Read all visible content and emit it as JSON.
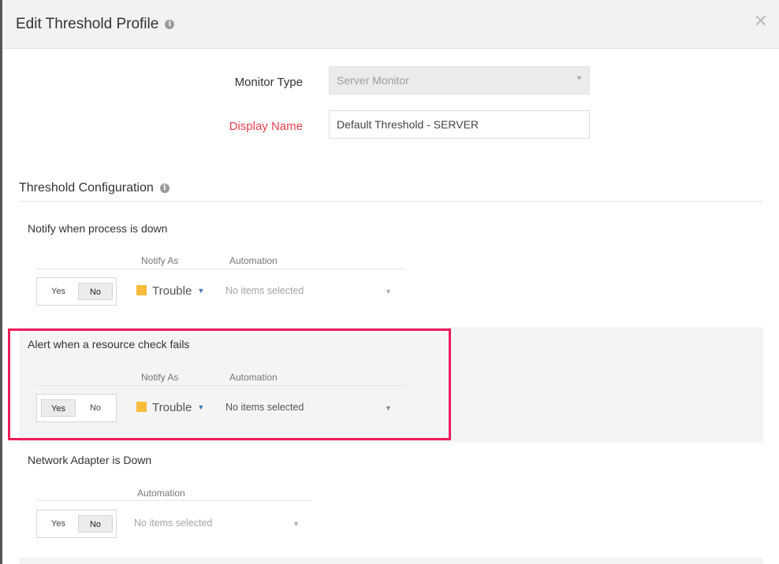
{
  "header": {
    "title": "Edit Threshold Profile",
    "info_icon": "i",
    "close_icon": "✕"
  },
  "form": {
    "monitor_type": {
      "label": "Monitor Type",
      "value": "Server Monitor"
    },
    "display_name": {
      "label": "Display Name",
      "value": "Default Threshold - SERVER",
      "label_color": "#e9424e"
    }
  },
  "threshold_config": {
    "title": "Threshold Configuration",
    "rules": [
      {
        "title": "Notify when process is down",
        "notify_as_header": "Notify As",
        "automation_header": "Automation",
        "yes_label": "Yes",
        "no_label": "No",
        "selected": "No",
        "severity": "Trouble",
        "automation": "No items selected"
      },
      {
        "title": "Alert when a resource check fails",
        "notify_as_header": "Notify As",
        "automation_header": "Automation",
        "yes_label": "Yes",
        "no_label": "No",
        "selected": "Yes",
        "severity": "Trouble",
        "automation": "No items selected",
        "highlighted": true
      },
      {
        "title": "Network Adapter is Down",
        "automation_header": "Automation",
        "yes_label": "Yes",
        "no_label": "No",
        "selected": "No",
        "automation": "No items selected"
      }
    ]
  },
  "colors": {
    "severity_trouble": "#f9bb3a",
    "highlight": "#ec1c5a"
  }
}
